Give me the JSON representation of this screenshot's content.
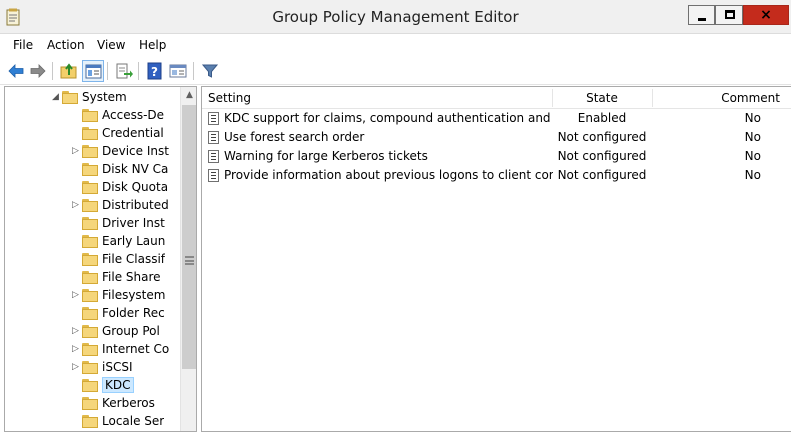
{
  "window": {
    "title": "Group Policy Management Editor",
    "close_glyph": "×"
  },
  "menu": [
    "File",
    "Action",
    "View",
    "Help"
  ],
  "toolbar": {
    "icons": [
      "back-arrow-icon",
      "forward-arrow-icon",
      "up-folder-icon",
      "show-hide-tree-icon",
      "export-list-icon",
      "help-icon",
      "properties-icon",
      "filter-icon"
    ]
  },
  "tree": {
    "expand_glyph": "◢",
    "collapse_glyph": "▷",
    "items": [
      {
        "label": "System",
        "arrow": "expanded",
        "selected": false
      },
      {
        "label": "Access-De",
        "arrow": "none",
        "selected": false
      },
      {
        "label": "Credential",
        "arrow": "none",
        "selected": false
      },
      {
        "label": "Device Inst",
        "arrow": "collapsed",
        "selected": false
      },
      {
        "label": "Disk NV Ca",
        "arrow": "none",
        "selected": false
      },
      {
        "label": "Disk Quota",
        "arrow": "none",
        "selected": false
      },
      {
        "label": "Distributed",
        "arrow": "collapsed",
        "selected": false
      },
      {
        "label": "Driver Inst",
        "arrow": "none",
        "selected": false
      },
      {
        "label": "Early Laun",
        "arrow": "none",
        "selected": false
      },
      {
        "label": "File Classif",
        "arrow": "none",
        "selected": false
      },
      {
        "label": "File Share",
        "arrow": "none",
        "selected": false
      },
      {
        "label": "Filesystem",
        "arrow": "collapsed",
        "selected": false
      },
      {
        "label": "Folder Rec",
        "arrow": "none",
        "selected": false
      },
      {
        "label": "Group Pol",
        "arrow": "collapsed",
        "selected": false
      },
      {
        "label": "Internet Co",
        "arrow": "collapsed",
        "selected": false
      },
      {
        "label": "iSCSI",
        "arrow": "collapsed",
        "selected": false
      },
      {
        "label": "KDC",
        "arrow": "none",
        "selected": true
      },
      {
        "label": "Kerberos",
        "arrow": "none",
        "selected": false
      },
      {
        "label": "Locale Ser",
        "arrow": "none",
        "selected": false
      }
    ],
    "scroll_up_glyph": "▲"
  },
  "list": {
    "columns": {
      "setting": "Setting",
      "state": "State",
      "comment": "Comment"
    },
    "rows": [
      {
        "setting": "KDC support for claims, compound authentication and Kerb...",
        "state": "Enabled",
        "comment": "No"
      },
      {
        "setting": "Use forest search order",
        "state": "Not configured",
        "comment": "No"
      },
      {
        "setting": "Warning for large Kerberos tickets",
        "state": "Not configured",
        "comment": "No"
      },
      {
        "setting": "Provide information about previous logons to client compu...",
        "state": "Not configured",
        "comment": "No"
      }
    ]
  }
}
